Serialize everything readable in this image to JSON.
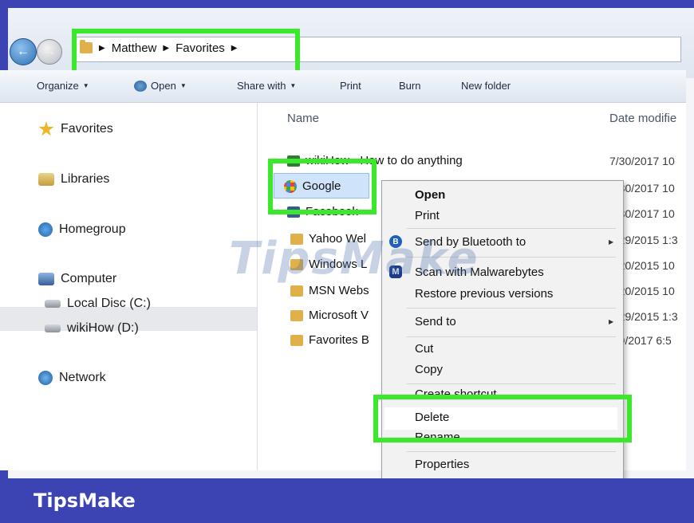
{
  "breadcrumb": {
    "items": [
      "Matthew",
      "Favorites"
    ]
  },
  "toolbar": {
    "organize": "Organize",
    "open": "Open",
    "share_with": "Share with",
    "print": "Print",
    "burn": "Burn",
    "new_folder": "New folder"
  },
  "sidebar": {
    "favorites": "Favorites",
    "libraries": "Libraries",
    "homegroup": "Homegroup",
    "computer": "Computer",
    "local_disc": "Local Disc (C:)",
    "wikihow_drive": "wikiHow (D:)",
    "network": "Network"
  },
  "files": {
    "header_name": "Name",
    "header_date": "Date modifie",
    "rows": [
      {
        "name": "wikiHow - How to do anything",
        "date": "7/30/2017 10"
      },
      {
        "name": "Google",
        "date": "7/30/2017 10"
      },
      {
        "name": "Facebook -",
        "date": "7/30/2017 10"
      },
      {
        "name": "Yahoo Wel",
        "date": "7/29/2015 1:3"
      },
      {
        "name": "Windows L",
        "date": "7/20/2015 10"
      },
      {
        "name": "MSN Webs",
        "date": "7/20/2015 10"
      },
      {
        "name": "Microsoft V",
        "date": "7/29/2015 1:3"
      },
      {
        "name": "Favorites B",
        "date": "7/9/2017 6:5"
      }
    ]
  },
  "context_menu": {
    "open": "Open",
    "print": "Print",
    "send_bluetooth": "Send by Bluetooth to",
    "scan_malwarebytes": "Scan with Malwarebytes",
    "restore_versions": "Restore previous versions",
    "send_to": "Send to",
    "cut": "Cut",
    "copy": "Copy",
    "create_shortcut": "Create shortcut",
    "delete": "Delete",
    "rename": "Rename",
    "properties": "Properties"
  },
  "watermark": "TipsMake",
  "brand": "TipsMake",
  "colors": {
    "highlight": "#3be82c",
    "banner": "#3c44b3"
  }
}
